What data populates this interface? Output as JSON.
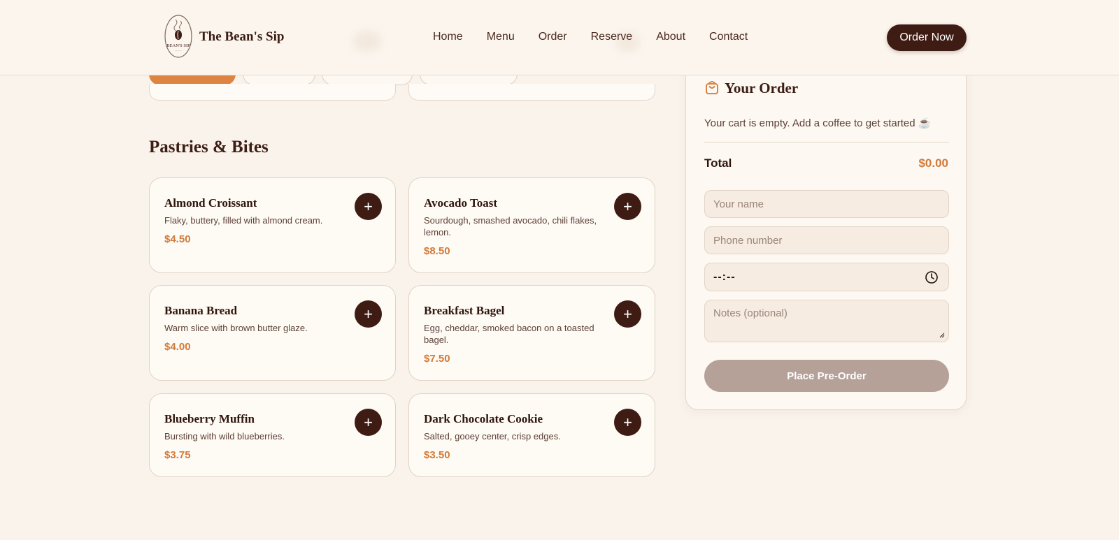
{
  "header": {
    "brand": "The Bean's Sip",
    "logo_text": "BEAN'S SIP",
    "nav": [
      "Home",
      "Menu",
      "Order",
      "Reserve",
      "About",
      "Contact"
    ],
    "cta": "Order Now"
  },
  "section": {
    "title": "Pastries & Bites",
    "items": [
      {
        "name": "Almond Croissant",
        "desc": "Flaky, buttery, filled with almond cream.",
        "price": "$4.50",
        "add": "+"
      },
      {
        "name": "Avocado Toast",
        "desc": "Sourdough, smashed avocado, chili flakes, lemon.",
        "price": "$8.50",
        "add": "+"
      },
      {
        "name": "Banana Bread",
        "desc": "Warm slice with brown butter glaze.",
        "price": "$4.00",
        "add": "+"
      },
      {
        "name": "Breakfast Bagel",
        "desc": "Egg, cheddar, smoked bacon on a toasted bagel.",
        "price": "$7.50",
        "add": "+"
      },
      {
        "name": "Blueberry Muffin",
        "desc": "Bursting with wild blueberries.",
        "price": "$3.75",
        "add": "+"
      },
      {
        "name": "Dark Chocolate Cookie",
        "desc": "Salted, gooey center, crisp edges.",
        "price": "$3.50",
        "add": "+"
      }
    ]
  },
  "order": {
    "title": "Your Order",
    "empty_message": "Your cart is empty. Add a coffee to get started ☕",
    "total_label": "Total",
    "total_value": "$0.00",
    "name_placeholder": "Your name",
    "phone_placeholder": "Phone number",
    "time_value": "--:--",
    "notes_placeholder": "Notes (optional)",
    "submit": "Place Pre-Order"
  },
  "colors": {
    "primary": "#3e1c14",
    "accent": "#d17a3a",
    "background": "#faf3ec"
  }
}
